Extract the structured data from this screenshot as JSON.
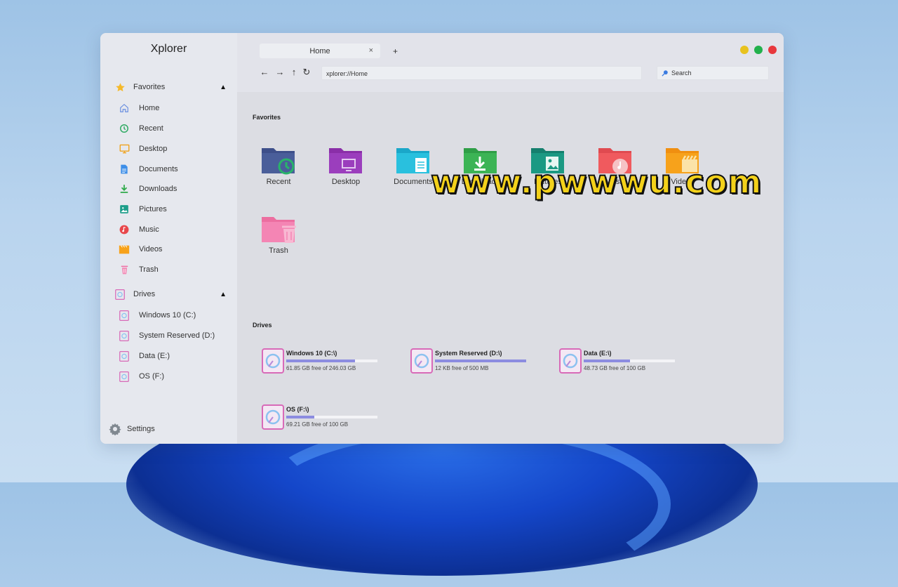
{
  "app": {
    "title": "Xplorer"
  },
  "colors": {
    "accent": "#8c8ce0",
    "dot_yellow": "#e8c21e",
    "dot_green": "#22b14c",
    "dot_red": "#e8383d"
  },
  "sidebar": {
    "favorites_header": {
      "label": "Favorites",
      "icon": "star-icon"
    },
    "favorites": [
      {
        "label": "Home",
        "icon": "home-icon"
      },
      {
        "label": "Recent",
        "icon": "recent-icon"
      },
      {
        "label": "Desktop",
        "icon": "desktop-icon"
      },
      {
        "label": "Documents",
        "icon": "document-icon"
      },
      {
        "label": "Downloads",
        "icon": "download-icon"
      },
      {
        "label": "Pictures",
        "icon": "picture-icon"
      },
      {
        "label": "Music",
        "icon": "music-icon"
      },
      {
        "label": "Videos",
        "icon": "video-icon"
      },
      {
        "label": "Trash",
        "icon": "trash-icon"
      }
    ],
    "drives_header": {
      "label": "Drives",
      "icon": "drive-icon"
    },
    "drives": [
      {
        "label": "Windows 10 (C:)"
      },
      {
        "label": "System Reserved (D:)"
      },
      {
        "label": "Data (E:)"
      },
      {
        "label": "OS (F:)"
      }
    ],
    "settings_label": "Settings"
  },
  "tabs": [
    {
      "title": "Home",
      "close": "×"
    }
  ],
  "new_tab": "+",
  "nav": {
    "back": "←",
    "forward": "→",
    "up": "↑",
    "refresh": "↻"
  },
  "address": {
    "value": "xplorer://Home"
  },
  "search": {
    "placeholder": "Search"
  },
  "main": {
    "favorites_title": "Favorites",
    "folders": [
      {
        "label": "Recent"
      },
      {
        "label": "Desktop"
      },
      {
        "label": "Documents"
      },
      {
        "label": "Downloads"
      },
      {
        "label": "Pictures"
      },
      {
        "label": "Music"
      },
      {
        "label": "Videos"
      },
      {
        "label": "Trash"
      }
    ],
    "drives_title": "Drives",
    "drives": [
      {
        "name": "Windows 10 (C:\\)",
        "free": "61.85 GB free of 246.03 GB",
        "used_fraction": 0.75
      },
      {
        "name": "System Reserved (D:\\)",
        "free": "12 KB free of 500 MB",
        "used_fraction": 1.0
      },
      {
        "name": "Data (E:\\)",
        "free": "48.73 GB free of 100 GB",
        "used_fraction": 0.51
      },
      {
        "name": "OS (F:\\)",
        "free": "69.21 GB free of 100 GB",
        "used_fraction": 0.31
      }
    ]
  },
  "watermark": "www.pwwwu.com"
}
